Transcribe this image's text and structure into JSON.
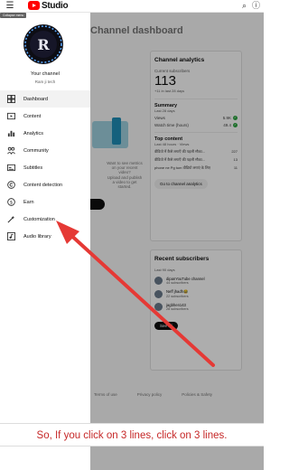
{
  "header": {
    "app_name": "Studio",
    "collapse_tooltip": "Collapse menu"
  },
  "drawer": {
    "channel_label": "Your channel",
    "channel_name": "Ram ji tech",
    "items": [
      {
        "label": "Dashboard",
        "icon": "dashboard-icon"
      },
      {
        "label": "Content",
        "icon": "content-icon"
      },
      {
        "label": "Analytics",
        "icon": "analytics-icon"
      },
      {
        "label": "Community",
        "icon": "community-icon"
      },
      {
        "label": "Subtitles",
        "icon": "subtitles-icon"
      },
      {
        "label": "Content detection",
        "icon": "copyright-icon"
      },
      {
        "label": "Earn",
        "icon": "earn-icon"
      },
      {
        "label": "Customization",
        "icon": "customization-icon"
      },
      {
        "label": "Audio library",
        "icon": "audio-library-icon"
      }
    ]
  },
  "main": {
    "title": "Channel dashboard",
    "upload_hint_1": "Want to see metrics on your recent video?",
    "upload_hint_2": "Upload and publish a video to get started."
  },
  "analytics": {
    "heading": "Channel analytics",
    "subs_label": "Current subscribers",
    "subs_count": "113",
    "subs_delta": "+11 in last 28 days",
    "summary_title": "Summary",
    "summary_sub": "Last 28 days",
    "stats": [
      {
        "label": "Views",
        "value": "5.9K"
      },
      {
        "label": "Watch time (hours)",
        "value": "49.4"
      }
    ],
    "top_title": "Top content",
    "top_sub": "Last 48 hours · Views",
    "top_items": [
      {
        "title": "वीडियो में कैसे लगाएँ की पहली मौका...",
        "value": "227"
      },
      {
        "title": "वीडियो में कैसे लगाएँ की पहली मौका...",
        "value": "13"
      },
      {
        "title": "phone ne Pg tum वीडियो लगाएं के लिए",
        "value": "11"
      }
    ],
    "go_button": "Go to channel analytics"
  },
  "recent": {
    "title": "Recent subscribers",
    "sub": "Last 90 days",
    "items": [
      {
        "name": "dipanYouTube channel",
        "meta": "44 subscribers"
      },
      {
        "name": "Neff jhadh😂",
        "meta": "22 subscribers"
      },
      {
        "name": "jagbhen143",
        "meta": "28 subscribers"
      }
    ],
    "see_all": "See all"
  },
  "footer": {
    "links": [
      "Terms of use",
      "Privacy policy",
      "Policies & Safety"
    ]
  },
  "annotation": {
    "caption": "So, If you click on 3 lines, click on 3 lines.",
    "color": "#e53935"
  }
}
